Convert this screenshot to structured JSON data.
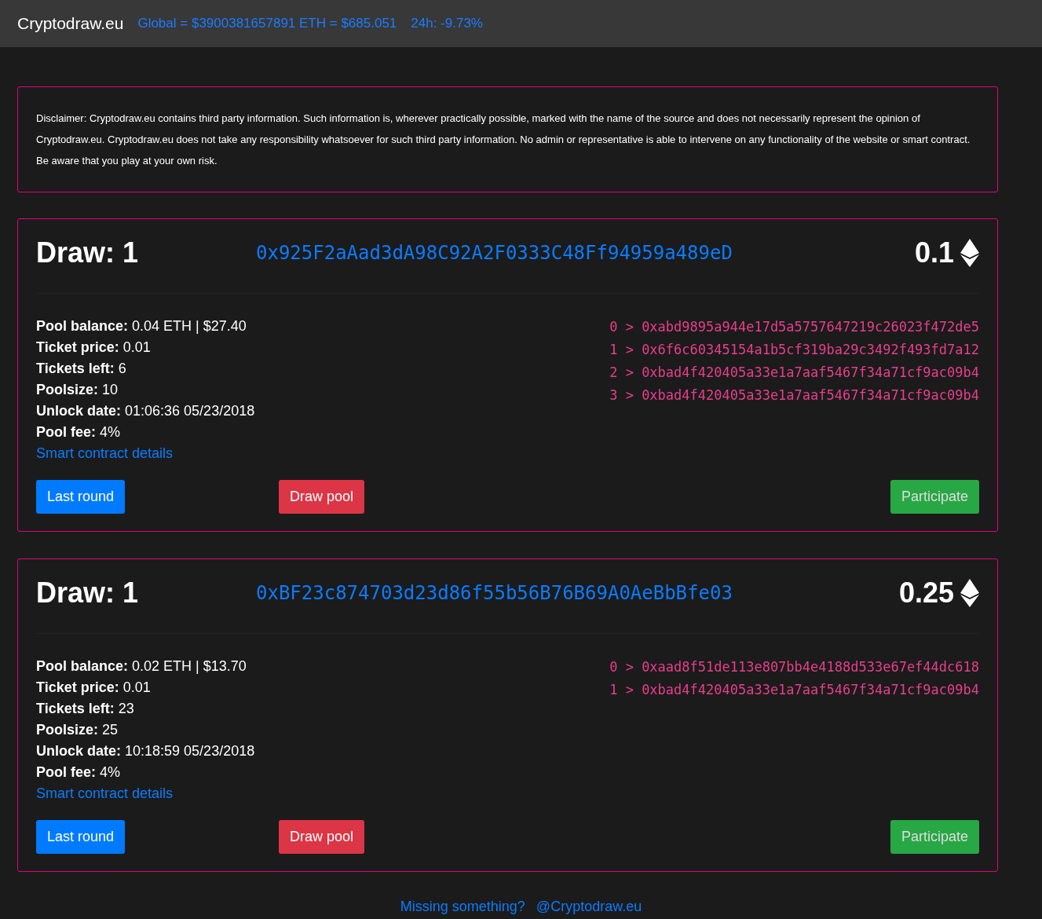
{
  "navbar": {
    "brand": "Cryptodraw.eu",
    "global": "Global = $3900381657891 ETH = $685.051",
    "change_24h": "24h: -9.73%"
  },
  "disclaimer": "Disclaimer: Cryptodraw.eu contains third party information. Such information is, wherever practically possible, marked with the name of the source and does not necessarily represent the opinion of Cryptodraw.eu. Cryptodraw.eu does not take any responsibility whatsoever for such third party information. No admin or representative is able to intervene on any functionality of the website or smart contract. Be aware that you play at your own risk.",
  "pools": [
    {
      "title": "Draw: 1",
      "address": "0x925F2aAad3dA98C92A2F0333C48Ff94959a489eD",
      "price": "0.1",
      "stats": [
        {
          "label": "Pool balance:",
          "value": "0.04 ETH | $27.40"
        },
        {
          "label": "Ticket price:",
          "value": "0.01"
        },
        {
          "label": "Tickets left:",
          "value": "6"
        },
        {
          "label": "Poolsize:",
          "value": "10"
        },
        {
          "label": "Unlock date:",
          "value": "01:06:36 05/23/2018"
        },
        {
          "label": "Pool fee:",
          "value": "4%"
        }
      ],
      "details_link": "Smart contract details",
      "tickets": [
        "0 > 0xabd9895a944e17d5a5757647219c26023f472de5",
        "1 > 0x6f6c60345154a1b5cf319ba29c3492f493fd7a12",
        "2 > 0xbad4f420405a33e1a7aaf5467f34a71cf9ac09b4",
        "3 > 0xbad4f420405a33e1a7aaf5467f34a71cf9ac09b4"
      ],
      "buttons": [
        {
          "label": "Last round",
          "kind": "primary"
        },
        {
          "label": "Draw pool",
          "kind": "danger"
        },
        {
          "label": "Participate",
          "kind": "success"
        }
      ]
    },
    {
      "title": "Draw: 1",
      "address": "0xBF23c874703d23d86f55b56B76B69A0AeBbBfe03",
      "price": "0.25",
      "stats": [
        {
          "label": "Pool balance:",
          "value": "0.02 ETH | $13.70"
        },
        {
          "label": "Ticket price:",
          "value": "0.01"
        },
        {
          "label": "Tickets left:",
          "value": "23"
        },
        {
          "label": "Poolsize:",
          "value": "25"
        },
        {
          "label": "Unlock date:",
          "value": "10:18:59 05/23/2018"
        },
        {
          "label": "Pool fee:",
          "value": "4%"
        }
      ],
      "details_link": "Smart contract details",
      "tickets": [
        "0 > 0xaad8f51de113e807bb4e4188d533e67ef44dc618",
        "1 > 0xbad4f420405a33e1a7aaf5467f34a71cf9ac09b4"
      ],
      "buttons": [
        {
          "label": "Last round",
          "kind": "primary"
        },
        {
          "label": "Draw pool",
          "kind": "danger"
        },
        {
          "label": "Participate",
          "kind": "success"
        }
      ]
    }
  ],
  "footer": {
    "question": "Missing something?",
    "handle": "@Cryptodraw.eu"
  }
}
